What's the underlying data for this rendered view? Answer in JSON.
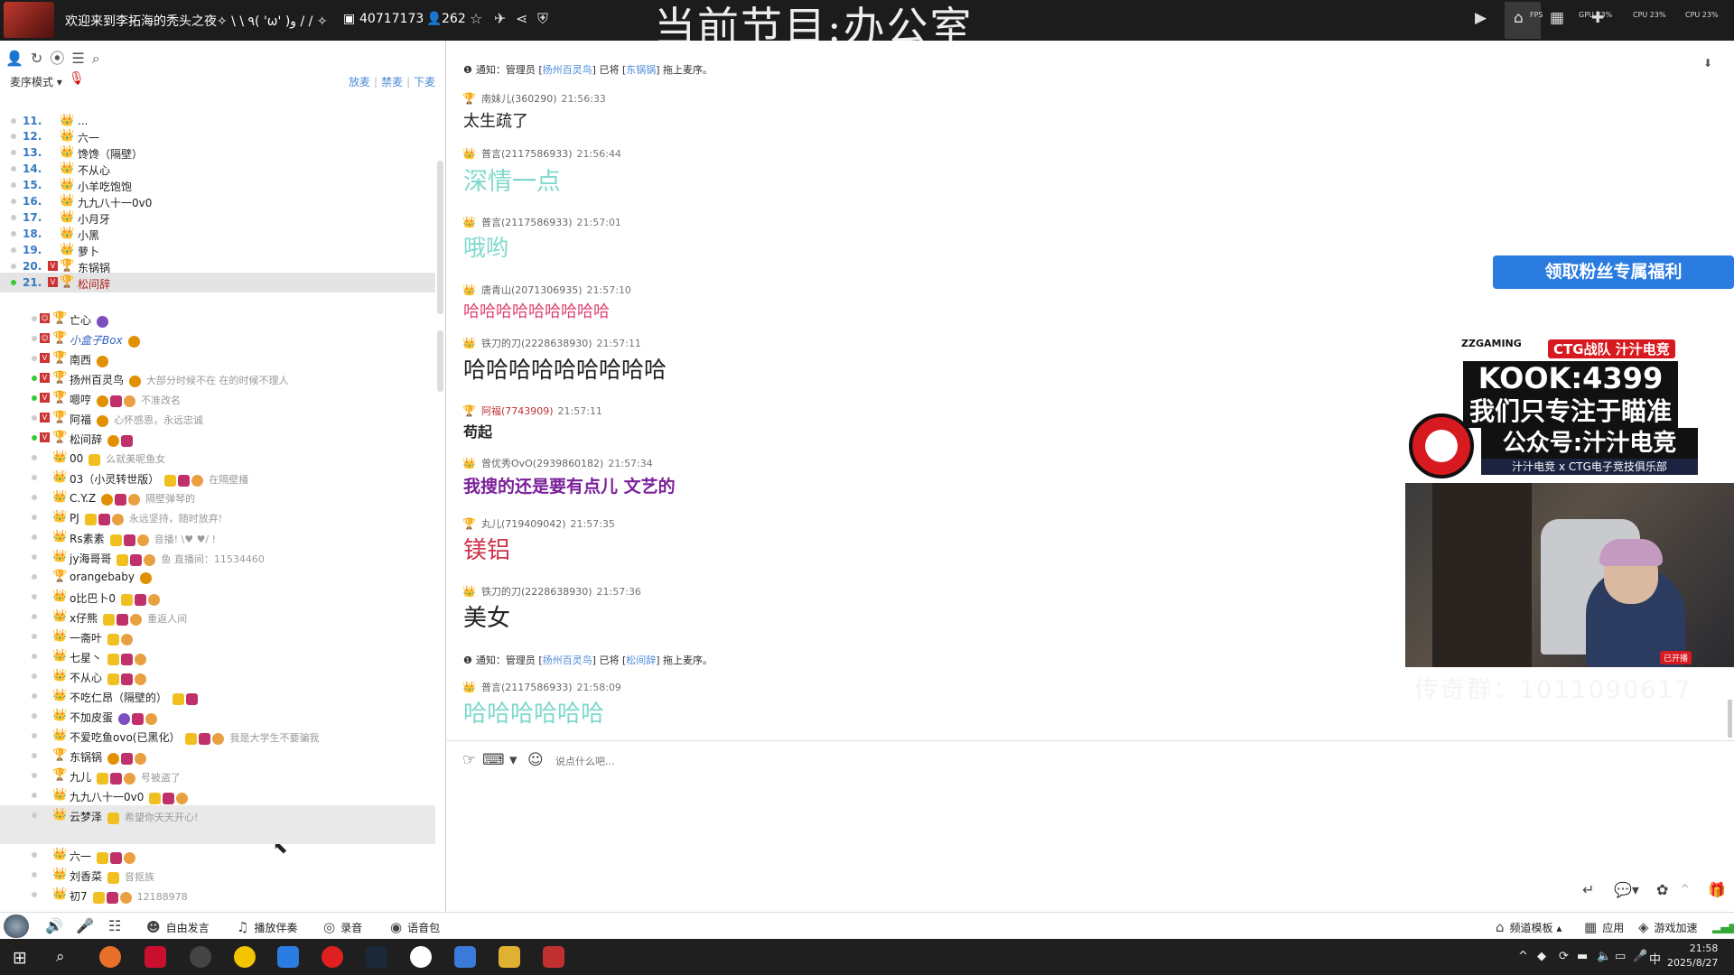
{
  "topbar": {
    "room_title": "欢迎来到李拓海的秃头之夜✧ \\ \\ ٩( 'ω' )و / / ✧",
    "room_id": "40717173",
    "viewers": "262",
    "program": "当前节目:办公室",
    "stats": [
      "FPS",
      "GPU 23%",
      "CPU 23%",
      "CPU 23%"
    ]
  },
  "sidebar": {
    "queue_mode": "麦序模式",
    "links": [
      "放麦",
      "禁麦",
      "下麦"
    ],
    "queue": [
      {
        "idx": "11.",
        "name": "..."
      },
      {
        "idx": "12.",
        "name": "六一"
      },
      {
        "idx": "13.",
        "name": "馋馋（隔壁）"
      },
      {
        "idx": "14.",
        "name": "不从心"
      },
      {
        "idx": "15.",
        "name": "小羊吃饱饱"
      },
      {
        "idx": "16.",
        "name": "九九八十一0v0"
      },
      {
        "idx": "17.",
        "name": "小月牙"
      },
      {
        "idx": "18.",
        "name": "小黑"
      },
      {
        "idx": "19.",
        "name": "萝卜"
      },
      {
        "idx": "20.",
        "name": "东锅锅"
      },
      {
        "idx": "21.",
        "name": "松间辞"
      }
    ],
    "members": [
      {
        "name": "亡心",
        "sig": ""
      },
      {
        "name": "小盒子Box",
        "sig": ""
      },
      {
        "name": "南西",
        "sig": ""
      },
      {
        "name": "扬州百灵鸟",
        "sig": "大部分时候不在 在的时候不理人"
      },
      {
        "name": "嗯哼",
        "sig": "不准改名"
      },
      {
        "name": "阿福",
        "sig": "心怀感恩，永远忠诚"
      },
      {
        "name": "松间辞",
        "sig": ""
      },
      {
        "name": "00",
        "sig": "么就美呢鱼女"
      },
      {
        "name": "03（小灵转世版）",
        "sig": "在隔壁播"
      },
      {
        "name": "C.Y.Z",
        "sig": "隔壁弹琴的"
      },
      {
        "name": "PJ",
        "sig": "永远坚持，随时放弃!"
      },
      {
        "name": "Rs素素",
        "sig": "音播! \\♥  ♥/ !"
      },
      {
        "name": "jy海哥哥",
        "sig": "鱼 直播间：11534460"
      },
      {
        "name": "orangebaby",
        "sig": ""
      },
      {
        "name": "o比巴卜0",
        "sig": ""
      },
      {
        "name": "x仔熊",
        "sig": "重返人间"
      },
      {
        "name": "一斋叶",
        "sig": ""
      },
      {
        "name": "七星丶",
        "sig": ""
      },
      {
        "name": "不从心",
        "sig": ""
      },
      {
        "name": "不吃仁昂（隔壁的）",
        "sig": ""
      },
      {
        "name": "不加皮蛋",
        "sig": ""
      },
      {
        "name": "不爱吃鱼ovo(已黑化）",
        "sig": "我是大学生不要骗我"
      },
      {
        "name": "东锅锅",
        "sig": ""
      },
      {
        "name": "九儿",
        "sig": "号被盗了"
      },
      {
        "name": "九九八十一0v0",
        "sig": ""
      },
      {
        "name": "云梦泽",
        "sig": "希望你天天开心!"
      },
      {
        "name": "六一",
        "sig": ""
      },
      {
        "name": "刘香菜",
        "sig": "音抠族"
      },
      {
        "name": "初7",
        "sig": "12188978"
      }
    ]
  },
  "chat": {
    "notices": [
      {
        "prefix": "通知：管理员 [",
        "admin": "扬州百灵鸟",
        "mid": "] 已将 [",
        "target": "东锅锅",
        "suffix": "] 拖上麦序。"
      },
      {
        "prefix": "通知：管理员 [",
        "admin": "扬州百灵鸟",
        "mid": "] 已将 [",
        "target": "松间辞",
        "suffix": "] 拖上麦序。"
      }
    ],
    "messages": [
      {
        "sender": "南妹儿(360290)",
        "time": "21:56:33",
        "text": "太生疏了",
        "color": "#222222"
      },
      {
        "sender": "普言(2117586933)",
        "time": "21:56:44",
        "text": "深情一点",
        "color": "#7fd8cc"
      },
      {
        "sender": "普言(2117586933)",
        "time": "21:57:01",
        "text": "哦哟",
        "color": "#7fd8cc"
      },
      {
        "sender": "唐青山(2071306935)",
        "time": "21:57:10",
        "text": "哈哈哈哈哈哈哈哈哈",
        "color": "#e04070"
      },
      {
        "sender": "铁刀的刀(2228638930)",
        "time": "21:57:11",
        "text": "哈哈哈哈哈哈哈哈哈",
        "color": "#222222"
      },
      {
        "sender": "阿福(7743909)",
        "time": "21:57:11",
        "text": "苟起",
        "color": "#222222"
      },
      {
        "sender": "曾优秀OvO(2939860182)",
        "time": "21:57:34",
        "text": "我搜的还是要有点儿 文艺的",
        "color": "#7a1f9a"
      },
      {
        "sender": "丸儿(719409042)",
        "time": "21:57:35",
        "text": "镁铝",
        "color": "#d0304a"
      },
      {
        "sender": "铁刀的刀(2228638930)",
        "time": "21:57:36",
        "text": "美女",
        "color": "#222222"
      },
      {
        "sender": "普言(2117586933)",
        "time": "21:58:09",
        "text": "哈哈哈哈哈哈",
        "color": "#7fd8cc"
      }
    ],
    "input_placeholder": "说点什么吧..."
  },
  "promo": {
    "fans_button": "领取粉丝专属福利",
    "brand": "ZZGAMING",
    "ctg": "CTG战队 汁汁电竞",
    "kook": "KOOK:4399",
    "slogan": "我们只专注于瞄准",
    "wechat": "公众号:汁汁电竞",
    "club": "汁汁电竞 x CTG电子竞技俱乐部",
    "watermark": "传奇群：1011090617",
    "live_tag": "已开播"
  },
  "bottombar": {
    "free_speak": "自由发言",
    "play_accompany": "播放伴奏",
    "record": "录音",
    "voice_pack": "语音包",
    "channel_template": "频道模板",
    "apps": "应用",
    "game_boost": "游戏加速"
  },
  "taskbar": {
    "time": "21:58",
    "date": "2025/8/27",
    "ime": "中"
  }
}
